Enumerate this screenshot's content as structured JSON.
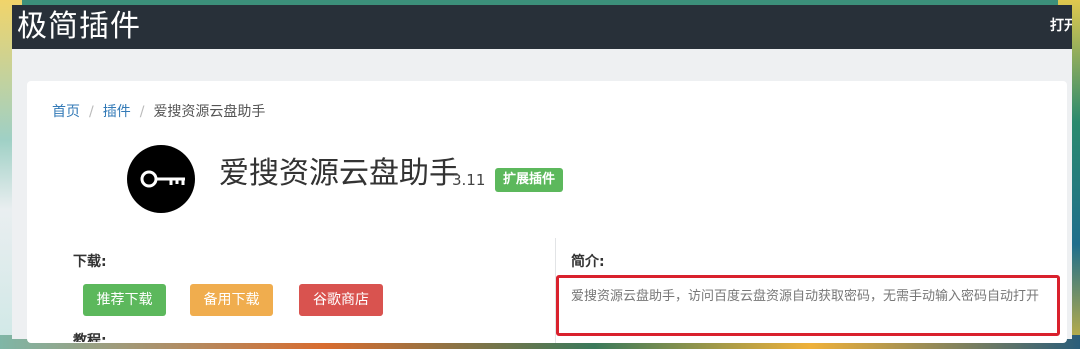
{
  "navbar": {
    "brand": "极简插件",
    "right_text": "打开"
  },
  "breadcrumb": {
    "home": "首页",
    "plugins": "插件",
    "current": "爱搜资源云盘助手"
  },
  "app": {
    "title": "爱搜资源云盘助手",
    "version": "3.11",
    "badge": "扩展插件",
    "logo_icon": "key-icon"
  },
  "download": {
    "label": "下载:",
    "buttons": {
      "recommended": "推荐下载",
      "backup": "备用下载",
      "store": "谷歌商店"
    }
  },
  "tutorial": {
    "label": "教程:"
  },
  "intro": {
    "label": "简介:",
    "text": "爱搜资源云盘助手，访问百度云盘资源自动获取密码，无需手动输入密码自动打开"
  },
  "colors": {
    "nav_bg": "#283039",
    "highlight_border": "#d9212d",
    "btn_green": "#5cb85c",
    "btn_orange": "#f0ad4e",
    "btn_red": "#d9534f"
  }
}
